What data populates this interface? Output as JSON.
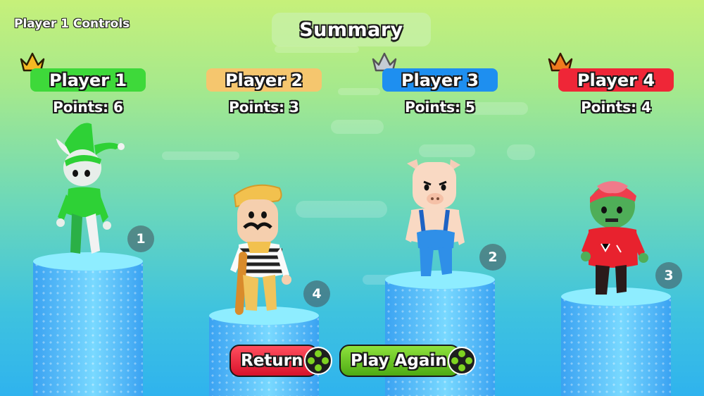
{
  "header": {
    "controls_label": "Player 1 Controls",
    "title": "Summary"
  },
  "players": [
    {
      "name": "Player 1",
      "points_label": "Points: 6",
      "rank": "1",
      "color": "#3ed93a",
      "crown": "gold-crown"
    },
    {
      "name": "Player 2",
      "points_label": "Points: 3",
      "rank": "4",
      "color": "#f5c66e",
      "crown": "none"
    },
    {
      "name": "Player 3",
      "points_label": "Points: 5",
      "rank": "2",
      "color": "#1e8ff0",
      "crown": "silver-crown"
    },
    {
      "name": "Player 4",
      "points_label": "Points: 4",
      "rank": "3",
      "color": "#ef2637",
      "crown": "bronze-crown"
    }
  ],
  "buttons": {
    "return_label": "Return",
    "play_again_label": "Play Again"
  }
}
